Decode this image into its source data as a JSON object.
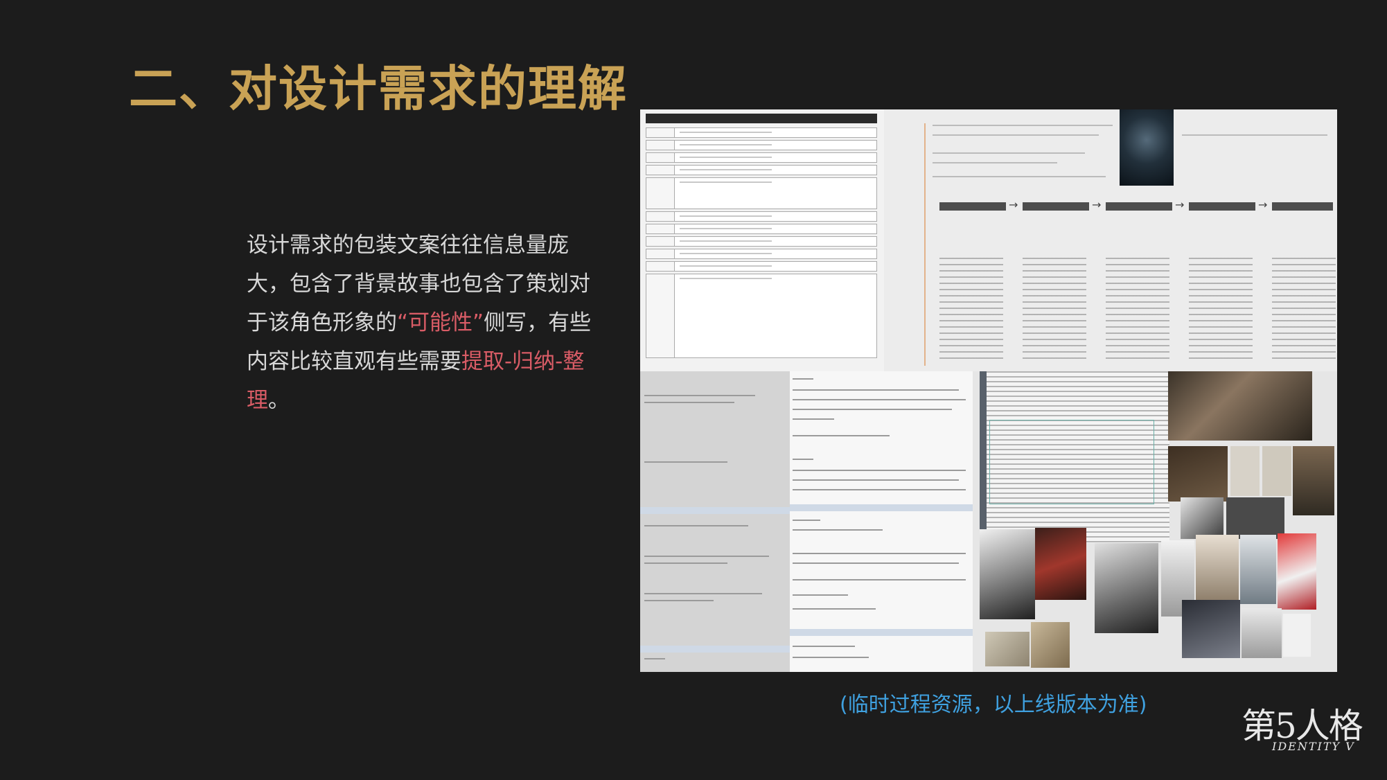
{
  "title": "二、对设计需求的理解",
  "body": {
    "part1": "设计需求的包装文案往往信息量庞大，包含了背景故事也包含了策划对于该角色形象的",
    "highlight1": "“可能性”",
    "part2": "侧写，有些内容比较直观有些需要",
    "highlight2": "提取-归纳-整理",
    "part3": "。"
  },
  "caption": "(临时过程资源，以上线版本为准)",
  "logo": {
    "cn": "第5人格",
    "en": "IDENTITY V"
  },
  "colors": {
    "title": "#c9a255",
    "highlight": "#d95c66",
    "caption": "#3fa1e0",
    "background": "#1c1c1c"
  }
}
